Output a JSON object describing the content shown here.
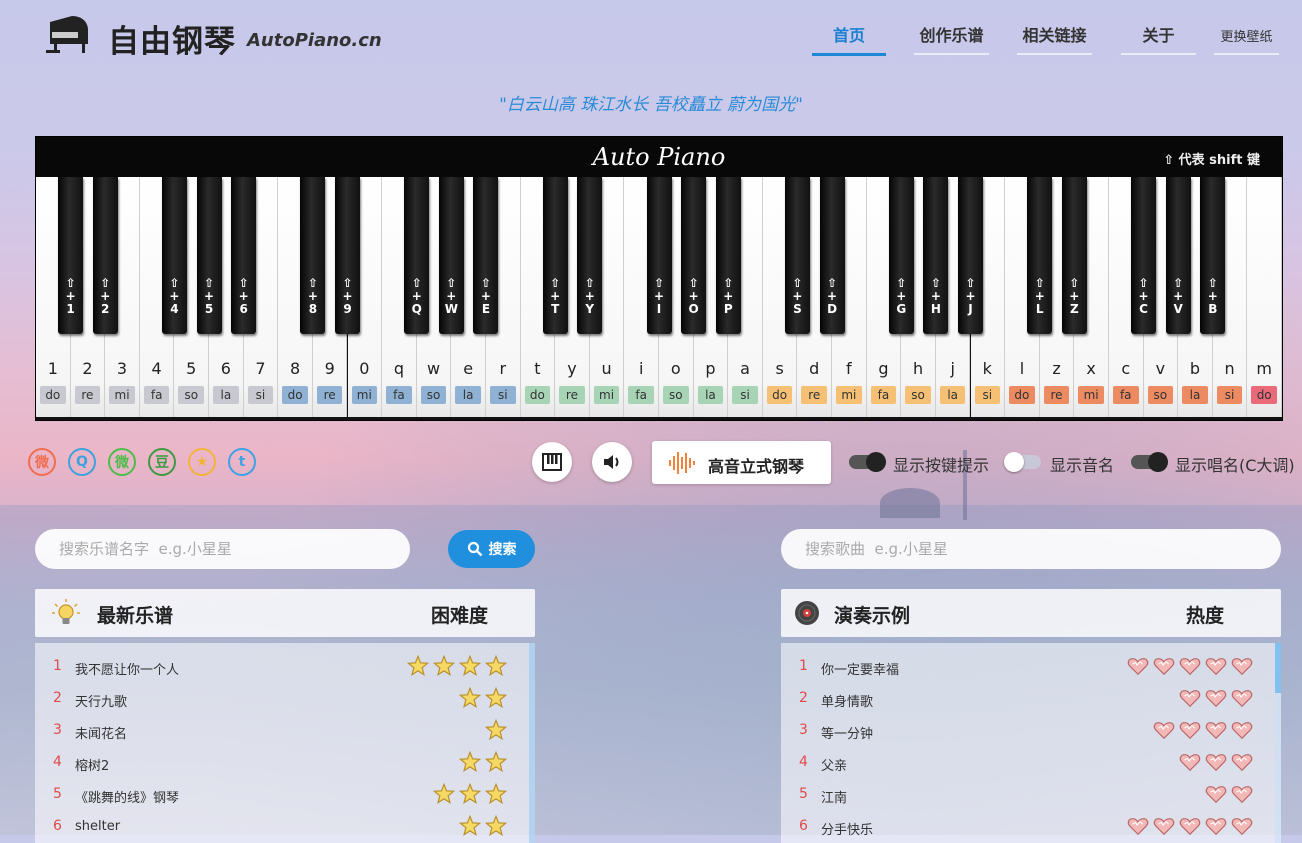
{
  "header": {
    "logo_text": "自由钢琴",
    "logo_en": "AutoPiano.cn",
    "nav": [
      {
        "label": "首页",
        "active": true
      },
      {
        "label": "创作乐谱",
        "active": false
      },
      {
        "label": "相关链接",
        "active": false
      },
      {
        "label": "关于",
        "active": false
      },
      {
        "label": "更换壁纸",
        "active": false
      }
    ]
  },
  "motto": "\"白云山高 珠江水长 吾校矗立 蔚为国光\"",
  "piano": {
    "title": "Auto Piano",
    "shift_note": "⇧ 代表 shift 键",
    "white_keys": [
      {
        "ch": "1",
        "sol": "do",
        "c": "#c8c8d0"
      },
      {
        "ch": "2",
        "sol": "re",
        "c": "#c8c8d0"
      },
      {
        "ch": "3",
        "sol": "mi",
        "c": "#c8c8d0"
      },
      {
        "ch": "4",
        "sol": "fa",
        "c": "#c8c8d0"
      },
      {
        "ch": "5",
        "sol": "so",
        "c": "#c8c8d0"
      },
      {
        "ch": "6",
        "sol": "la",
        "c": "#c8c8d0"
      },
      {
        "ch": "7",
        "sol": "si",
        "c": "#c8c8d0"
      },
      {
        "ch": "8",
        "sol": "do",
        "c": "#8fb1d3"
      },
      {
        "ch": "9",
        "sol": "re",
        "c": "#8fb1d3"
      },
      {
        "ch": "0",
        "sol": "mi",
        "c": "#8fb1d3"
      },
      {
        "ch": "q",
        "sol": "fa",
        "c": "#8fb1d3"
      },
      {
        "ch": "w",
        "sol": "so",
        "c": "#8fb1d3"
      },
      {
        "ch": "e",
        "sol": "la",
        "c": "#8fb1d3"
      },
      {
        "ch": "r",
        "sol": "si",
        "c": "#8fb1d3"
      },
      {
        "ch": "t",
        "sol": "do",
        "c": "#a8d4b6"
      },
      {
        "ch": "y",
        "sol": "re",
        "c": "#a8d4b6"
      },
      {
        "ch": "u",
        "sol": "mi",
        "c": "#a8d4b6"
      },
      {
        "ch": "i",
        "sol": "fa",
        "c": "#a8d4b6"
      },
      {
        "ch": "o",
        "sol": "so",
        "c": "#a8d4b6"
      },
      {
        "ch": "p",
        "sol": "la",
        "c": "#a8d4b6"
      },
      {
        "ch": "a",
        "sol": "si",
        "c": "#a8d4b6"
      },
      {
        "ch": "s",
        "sol": "do",
        "c": "#f5c073"
      },
      {
        "ch": "d",
        "sol": "re",
        "c": "#f5c073"
      },
      {
        "ch": "f",
        "sol": "mi",
        "c": "#f5c073"
      },
      {
        "ch": "g",
        "sol": "fa",
        "c": "#f5c073"
      },
      {
        "ch": "h",
        "sol": "so",
        "c": "#f5c073"
      },
      {
        "ch": "j",
        "sol": "la",
        "c": "#f5c073"
      },
      {
        "ch": "k",
        "sol": "si",
        "c": "#f5c073"
      },
      {
        "ch": "l",
        "sol": "do",
        "c": "#ec8a62"
      },
      {
        "ch": "z",
        "sol": "re",
        "c": "#ec8a62"
      },
      {
        "ch": "x",
        "sol": "mi",
        "c": "#ec8a62"
      },
      {
        "ch": "c",
        "sol": "fa",
        "c": "#ec8a62"
      },
      {
        "ch": "v",
        "sol": "so",
        "c": "#ec8a62"
      },
      {
        "ch": "b",
        "sol": "la",
        "c": "#ec8a62"
      },
      {
        "ch": "n",
        "sol": "si",
        "c": "#ec8a62"
      },
      {
        "ch": "m",
        "sol": "do",
        "c": "#ea6a7a"
      }
    ],
    "black_keys": [
      "1",
      "2",
      "4",
      "5",
      "6",
      "8",
      "9",
      "Q",
      "W",
      "E",
      "T",
      "Y",
      "I",
      "O",
      "P",
      "S",
      "D",
      "G",
      "H",
      "J",
      "L",
      "Z",
      "C",
      "V",
      "B"
    ]
  },
  "controls": {
    "social_icons": [
      {
        "name": "weibo-icon",
        "glyph": "微",
        "color": "#f06e4e"
      },
      {
        "name": "qq-icon",
        "glyph": "Q",
        "color": "#3ea2dc"
      },
      {
        "name": "wechat-icon",
        "glyph": "微",
        "color": "#4dbd4a"
      },
      {
        "name": "douban-icon",
        "glyph": "豆",
        "color": "#3f9a43"
      },
      {
        "name": "qzone-icon",
        "glyph": "★",
        "color": "#f3b33a"
      },
      {
        "name": "twitter-icon",
        "glyph": "t",
        "color": "#3fa2e6"
      }
    ],
    "instrument": "高音立式钢琴",
    "toggles": [
      {
        "label": "显示按键提示",
        "on": true
      },
      {
        "label": "显示音名",
        "on": false
      },
      {
        "label": "显示唱名(C大调)",
        "on": true
      }
    ]
  },
  "search": {
    "sheets_placeholder": "搜索乐谱名字  e.g.小星星",
    "button": "搜索",
    "songs_placeholder": "搜索歌曲  e.g.小星星"
  },
  "latest": {
    "title": "最新乐谱",
    "right": "困难度",
    "items": [
      {
        "num": "1",
        "name": "我不愿让你一个人",
        "rating": 4
      },
      {
        "num": "2",
        "name": "天行九歌",
        "rating": 2
      },
      {
        "num": "3",
        "name": "未闻花名",
        "rating": 1
      },
      {
        "num": "4",
        "name": "榕树2",
        "rating": 2
      },
      {
        "num": "5",
        "name": "《跳舞的线》钢琴",
        "rating": 3
      },
      {
        "num": "6",
        "name": "shelter",
        "rating": 2
      }
    ]
  },
  "demos": {
    "title": "演奏示例",
    "right": "热度",
    "items": [
      {
        "num": "1",
        "name": "你一定要幸福",
        "rating": 5
      },
      {
        "num": "2",
        "name": "单身情歌",
        "rating": 3
      },
      {
        "num": "3",
        "name": "等一分钟",
        "rating": 4
      },
      {
        "num": "4",
        "name": "父亲",
        "rating": 3
      },
      {
        "num": "5",
        "name": "江南",
        "rating": 2
      },
      {
        "num": "6",
        "name": "分手快乐",
        "rating": 5
      }
    ]
  }
}
